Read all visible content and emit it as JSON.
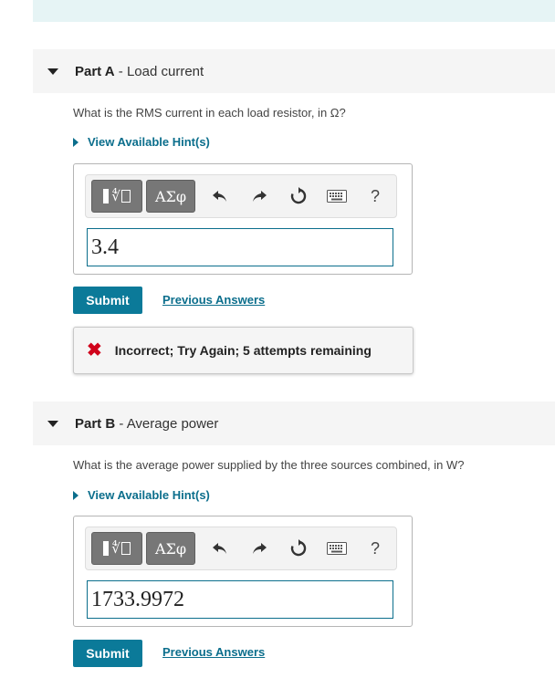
{
  "partA": {
    "label": "Part A",
    "title": "- Load current",
    "question": "What is the RMS current in each load resistor, in Ω?",
    "hint": "View Available Hint(s)",
    "greek_label": "ΑΣφ",
    "help_label": "?",
    "answer_value": "3.4",
    "submit_label": "Submit",
    "previous_answers_label": "Previous Answers",
    "feedback": "Incorrect; Try Again; 5 attempts remaining"
  },
  "partB": {
    "label": "Part B",
    "title": "- Average power",
    "question": "What is the average power supplied by the three sources combined, in W?",
    "hint": "View Available Hint(s)",
    "greek_label": "ΑΣφ",
    "help_label": "?",
    "answer_value": "1733.9972",
    "submit_label": "Submit",
    "previous_answers_label": "Previous Answers"
  },
  "icons": {
    "template": "fraction-radical-icon",
    "undo": "undo-icon",
    "redo": "redo-icon",
    "reset": "reset-icon",
    "keyboard": "keyboard-icon",
    "help": "help-icon",
    "incorrect": "x-icon"
  },
  "colors": {
    "accent": "#0b7a99",
    "link": "#0b6e8c",
    "error": "#d0021b",
    "header_bg": "#f5f5f5",
    "top_band": "#e6f4f5"
  }
}
